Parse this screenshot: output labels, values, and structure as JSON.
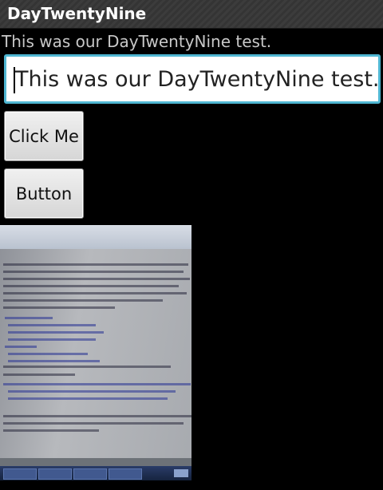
{
  "app": {
    "title": "DayTwentyNine"
  },
  "main": {
    "text_view": "This was our DayTwentyNine test.",
    "edit_text_value": "This was our DayTwentyNine test.",
    "buttons": {
      "click_me_label": "Click Me",
      "button_label": "Button"
    },
    "photo": {
      "semantic": "captured-camera-image"
    }
  },
  "colors": {
    "background": "#000000",
    "edit_border": "#4fb6d2",
    "title_text": "#ffffff"
  }
}
